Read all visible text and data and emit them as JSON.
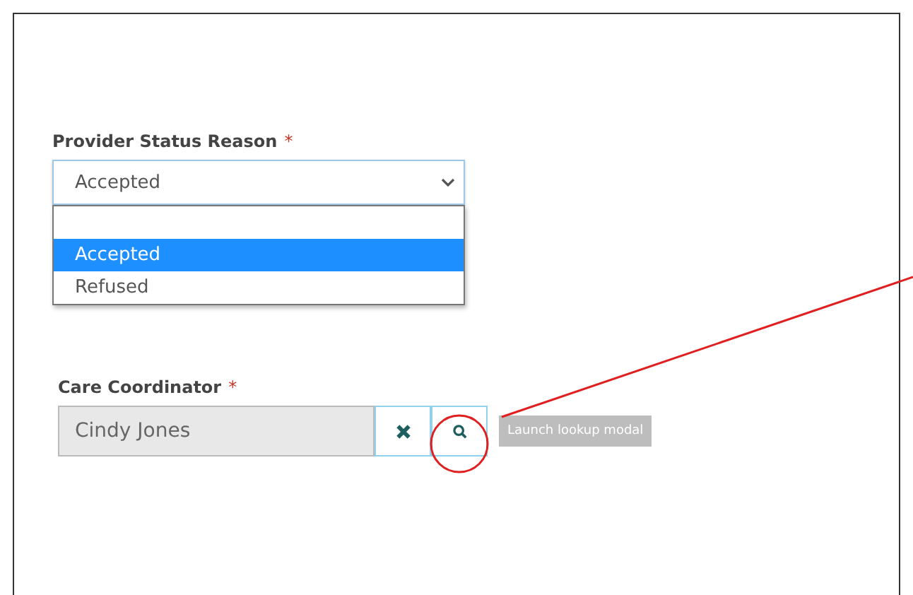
{
  "provider_status_reason": {
    "label": "Provider Status Reason",
    "required_mark": "*",
    "value": "Accepted",
    "dropdown_open": true,
    "options": [
      {
        "label": "Accepted",
        "selected": true
      },
      {
        "label": "Refused",
        "selected": false
      }
    ]
  },
  "care_coordinator": {
    "label": "Care Coordinator",
    "required_mark": "*",
    "value": "Cindy Jones",
    "lookup_button_highlighted": true,
    "tooltip": "Launch lookup modal"
  }
}
